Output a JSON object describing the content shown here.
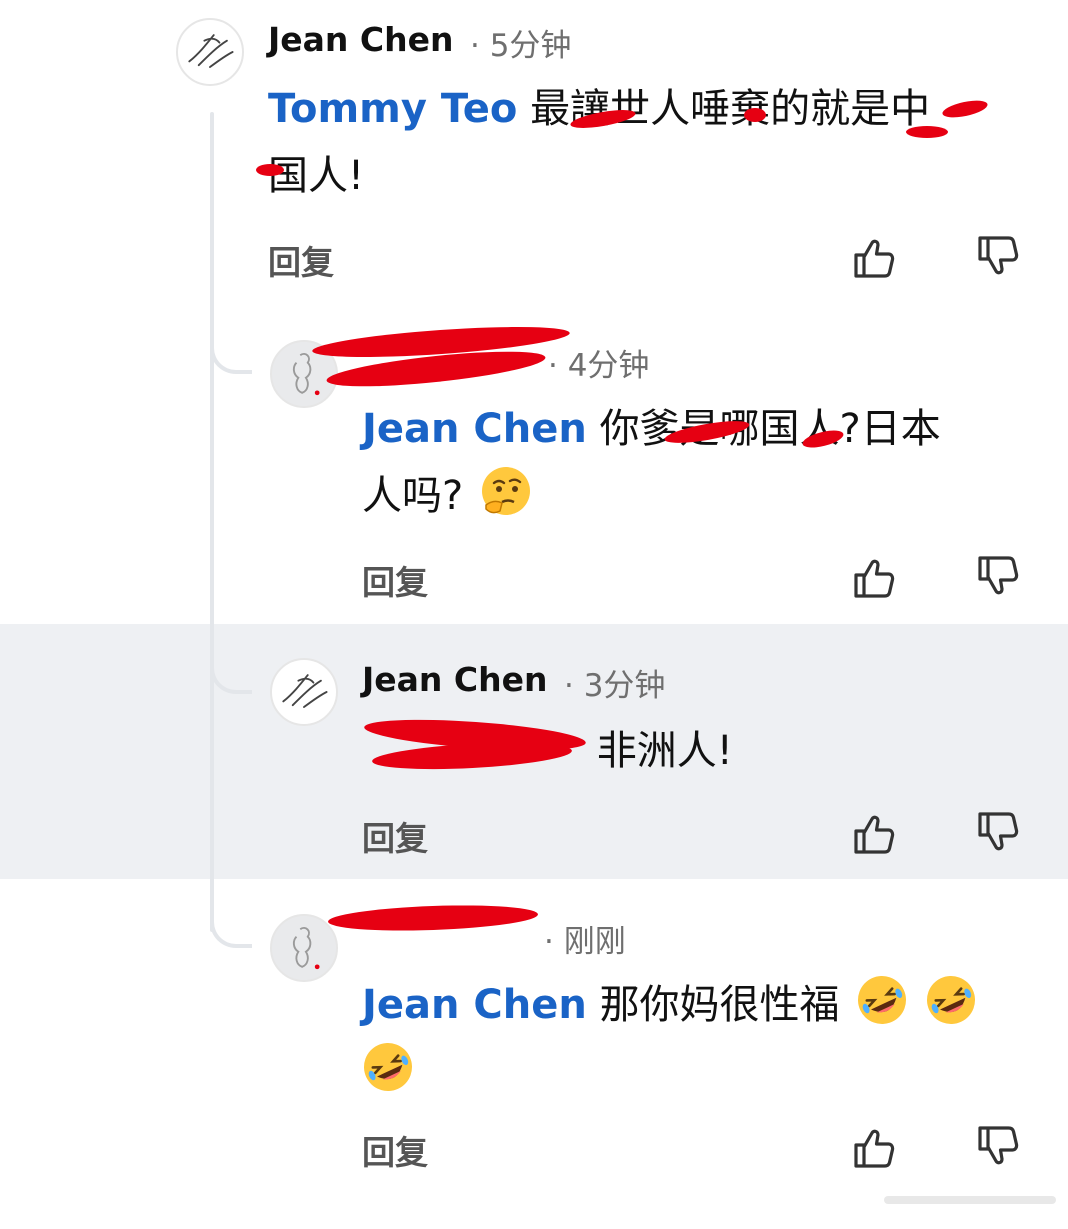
{
  "comments": [
    {
      "author": "Jean  Chen",
      "time": "· 5分钟",
      "mention": "Tommy Teo",
      "line1": "最讓世人唾棄的就是中",
      "line2": "国人!",
      "reply_label": "回复"
    },
    {
      "author": "",
      "time": "· 4分钟",
      "mention": "Jean  Chen",
      "line1": "你爹是哪国人?日本",
      "line2": "人吗?",
      "reply_label": "回复",
      "emoji": "thinking-face"
    },
    {
      "author": "Jean  Chen",
      "time": "· 3分钟",
      "mention": "",
      "line1": "非洲人!",
      "reply_label": "回复"
    },
    {
      "author": "",
      "time": "· 刚刚",
      "mention": "Jean  Chen",
      "line1": "那你妈很性福",
      "reply_label": "回复",
      "emoji": "rolling-on-floor-laughing"
    }
  ],
  "colors": {
    "mention": "#1a63c6",
    "redaction": "#e60012",
    "highlight": "#eef0f3",
    "thread_line": "#e3e6ea"
  },
  "icons": {
    "like": "thumbs-up-outline",
    "dislike": "thumbs-down-outline"
  }
}
